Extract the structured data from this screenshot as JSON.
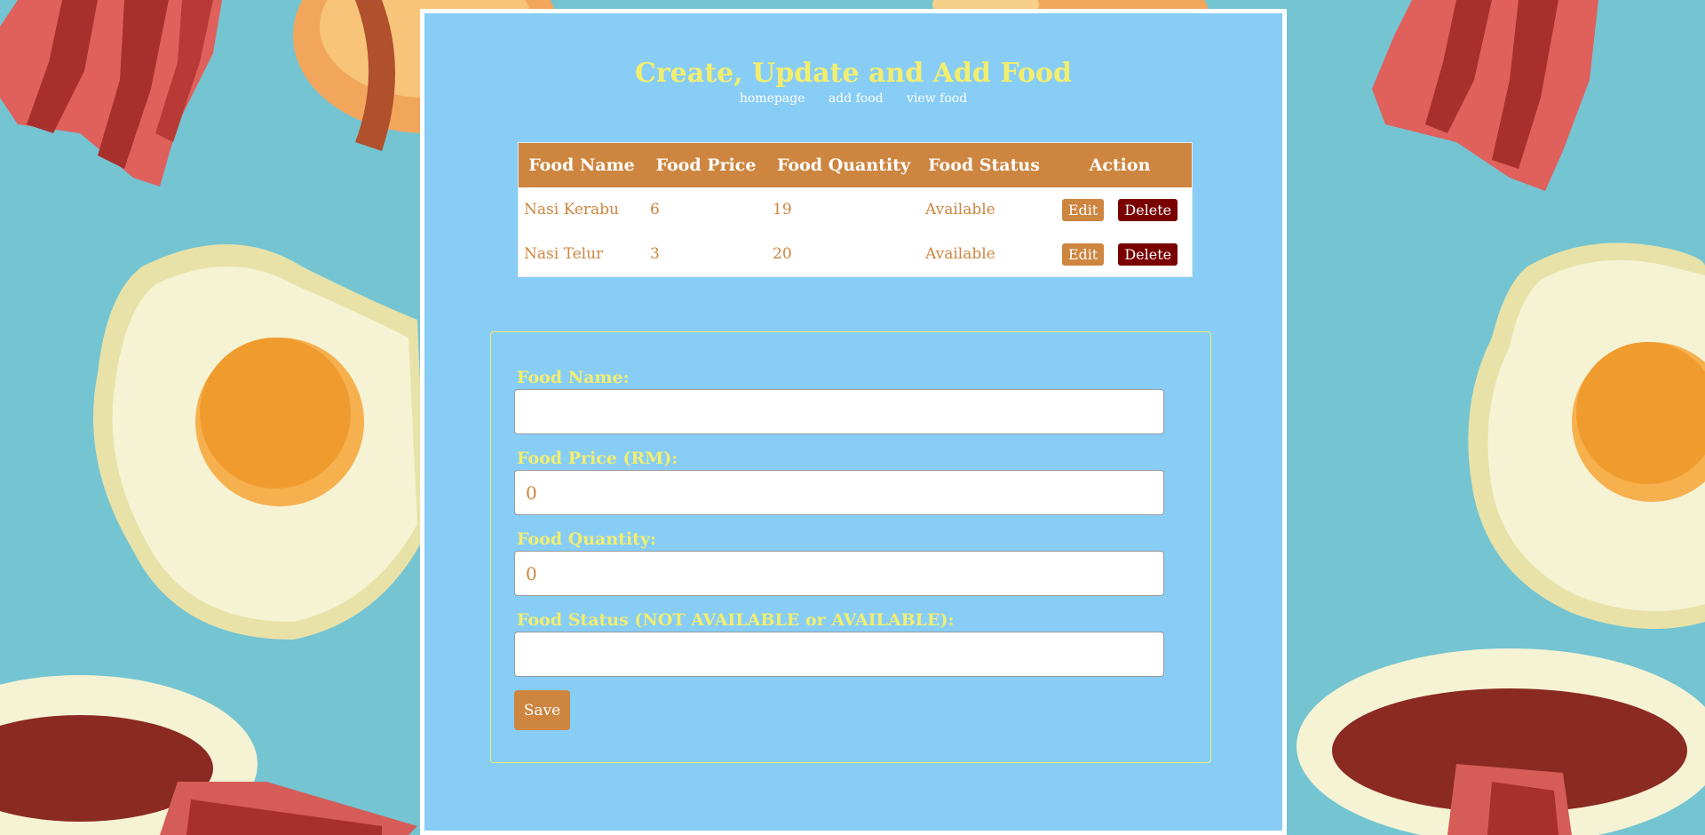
{
  "page": {
    "title": "Create, Update and Add Food"
  },
  "nav": {
    "links": [
      {
        "label": "homepage"
      },
      {
        "label": "add food"
      },
      {
        "label": "view food"
      }
    ]
  },
  "table": {
    "headers": [
      "Food Name",
      "Food Price",
      "Food Quantity",
      "Food Status",
      "Action"
    ],
    "rows": [
      {
        "name": "Nasi Kerabu",
        "price": "6",
        "quantity": "19",
        "status": "Available"
      },
      {
        "name": "Nasi Telur",
        "price": "3",
        "quantity": "20",
        "status": "Available"
      }
    ],
    "edit_label": "Edit",
    "delete_label": "Delete"
  },
  "form": {
    "name_label": "Food Name:",
    "name_value": "",
    "price_label": "Food Price (RM):",
    "price_value": "0",
    "quantity_label": "Food Quantity:",
    "quantity_value": "0",
    "status_label": "Food Status (NOT AVAILABLE or AVAILABLE):",
    "status_value": "",
    "save_label": "Save"
  },
  "colors": {
    "panel_bg": "#87cdf6",
    "accent": "#cd853f",
    "title": "#f3ee6e",
    "delete": "#7a0000",
    "page_bg": "#74c4d2"
  }
}
